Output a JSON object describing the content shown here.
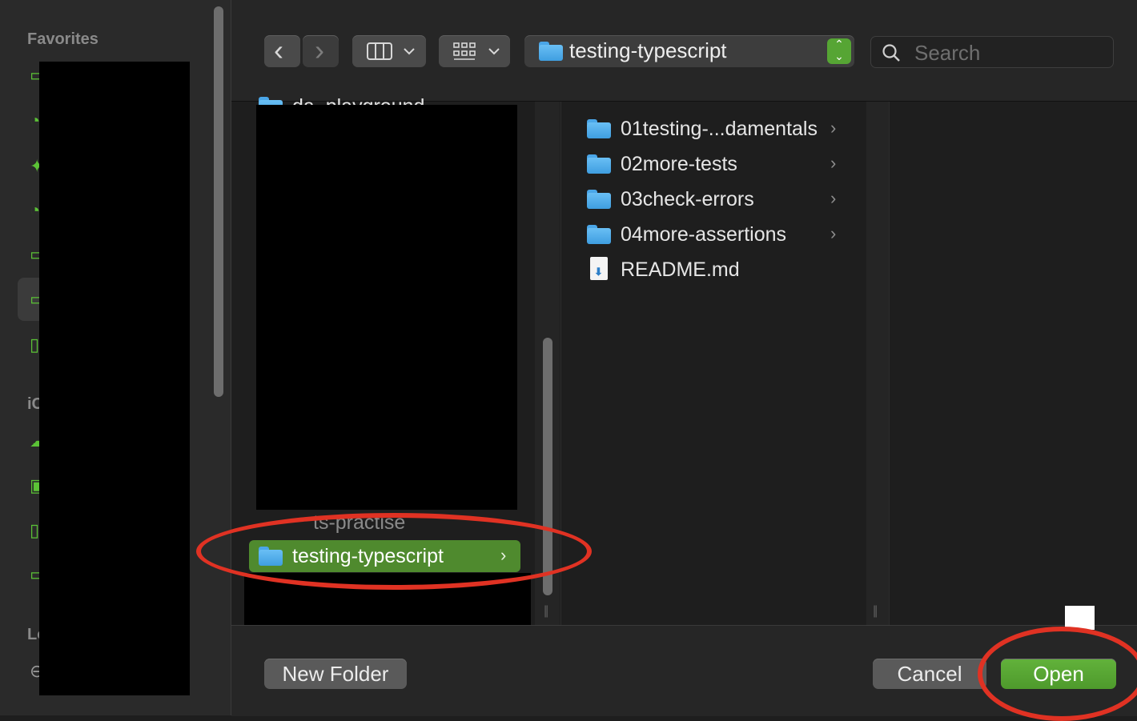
{
  "sidebar": {
    "favorites_heading": "Favorites",
    "icloud_heading": "iC",
    "locations_heading": "Lo",
    "icons": [
      "folder-icon",
      "clock-icon",
      "apps-icon",
      "download-icon",
      "folder-icon",
      "folder-icon",
      "doc-icon",
      "cloud-icon",
      "drive-icon",
      "doc-icon",
      "folder-icon",
      "disk-icon"
    ]
  },
  "toolbar": {
    "back": "‹",
    "forward": "›",
    "view_mode": "columns",
    "group_mode": "grid",
    "path_label": "testing-typescript",
    "search_placeholder": "Search"
  },
  "column1": {
    "partial_top_label": "da_playground",
    "partial_bottom_label": "ts-practise",
    "selected_label": "testing-typescript"
  },
  "column2": {
    "items": [
      {
        "label": "01testing-...damentals",
        "type": "folder",
        "chevron": "›"
      },
      {
        "label": "02more-tests",
        "type": "folder",
        "chevron": "›"
      },
      {
        "label": "03check-errors",
        "type": "folder",
        "chevron": "›"
      },
      {
        "label": "04more-assertions",
        "type": "folder",
        "chevron": "›"
      },
      {
        "label": "README.md",
        "type": "file",
        "chevron": ""
      }
    ]
  },
  "bottom": {
    "new_folder_label": "New Folder",
    "cancel_label": "Cancel",
    "open_label": "Open"
  },
  "colors": {
    "accent_green": "#56a534",
    "selection_green": "#4f8a2e",
    "annotation_red": "#e03223"
  }
}
